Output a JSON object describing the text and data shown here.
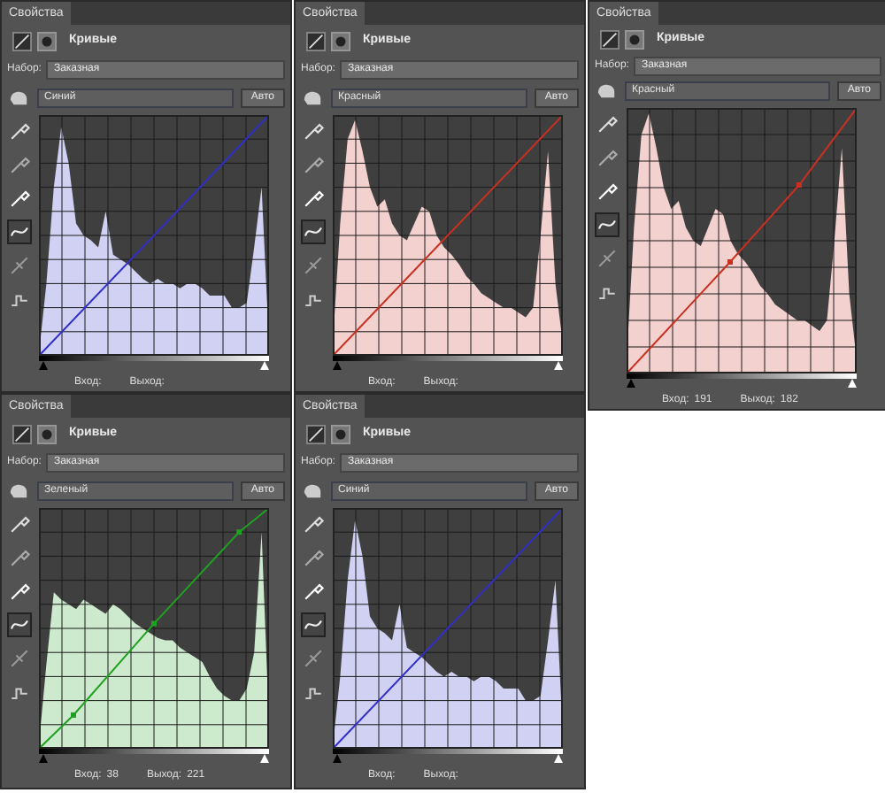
{
  "panels": [
    {
      "tab": "Свойства",
      "title": "Кривые",
      "preset_label": "Набор:",
      "preset": "Заказная",
      "channel": "Синий",
      "auto_button": "Авто",
      "input_label": "Вход:",
      "output_label": "Выход:",
      "color": "#3030c8"
    },
    {
      "tab": "Свойства",
      "title": "Кривые",
      "preset_label": "Набор:",
      "preset": "Заказная",
      "channel": "Красный",
      "auto_button": "Авто",
      "input_label": "Вход:",
      "output_label": "Выход:",
      "color": "#c83020"
    },
    {
      "tab": "Свойства",
      "title": "Кривые",
      "preset_label": "Набор:",
      "preset": "Заказная",
      "channel": "Красный",
      "auto_button": "Авто",
      "input_label": "Вход:",
      "input_value": "191",
      "output_label": "Выход:",
      "output_value": "182",
      "color": "#c83020"
    },
    {
      "tab": "Свойства",
      "title": "Кривые",
      "preset_label": "Набор:",
      "preset": "Заказная",
      "channel": "Зеленый",
      "auto_button": "Авто",
      "input_label": "Вход:",
      "input_value": "38",
      "output_label": "Выход:",
      "output_value": "221",
      "color": "#20a020"
    },
    {
      "tab": "Свойства",
      "title": "Кривые",
      "preset_label": "Набор:",
      "preset": "Заказная",
      "channel": "Синий",
      "auto_button": "Авто",
      "input_label": "Вход:",
      "output_label": "Выход:",
      "color": "#3030c8"
    }
  ]
}
